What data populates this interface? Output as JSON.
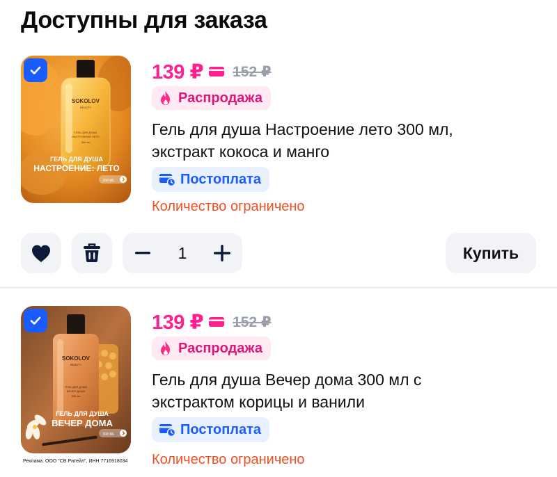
{
  "section": {
    "title": "Доступны для заказа"
  },
  "products": [
    {
      "price_now": "139 ₽",
      "price_old": "152 ₽",
      "sale_label": "Распродажа",
      "title_line1": "Гель для душа Настроение лето 300 мл,",
      "title_line2": "экстракт кокоса и манго",
      "payment_label": "Постоплата",
      "availability": "Количество ограничено",
      "quantity": "1",
      "buy_label": "Купить",
      "image": {
        "brand": "SOKOLOV",
        "brand_sub": "BEAUTY",
        "caption_line1": "ГЕЛЬ ДЛЯ ДУША",
        "caption_line2": "НАСТРОЕНИЕ: ЛЕТО",
        "volume": "300 ML",
        "bottle_label_line1": "ГЕЛЬ ДЛЯ ДУША",
        "bottle_label_line2": "НАСТРОЕНИЕ ЛЕТО",
        "bottle_volume": "300 мл"
      }
    },
    {
      "price_now": "139 ₽",
      "price_old": "152 ₽",
      "sale_label": "Распродажа",
      "title_line1": "Гель для душа Вечер дома 300 мл с",
      "title_line2": "экстрактом корицы и ванили",
      "payment_label": "Постоплата",
      "availability": "Количество ограничено",
      "ad_note": "Реклама. ООО \"СВ Ритейл\", ИНН 7716918034",
      "image": {
        "brand": "SOKOLOV",
        "brand_sub": "BEAUTY",
        "caption_line1": "ГЕЛЬ ДЛЯ ДУША",
        "caption_line2": "ВЕЧЕР ДОМА",
        "volume": "300 ML",
        "bottle_label_line1": "ГЕЛЬ ДЛЯ ДУША",
        "bottle_label_line2": "ВЕЧЕР ДОМА",
        "bottle_volume": "300 мл"
      }
    }
  ],
  "colors": {
    "price": "#ff1f8f",
    "sale_bg": "#ffeaf3",
    "sale_text": "#e0167a",
    "post_bg": "#e9f1ff",
    "post_text": "#1a5cff",
    "limited": "#f14f1f",
    "checkbox": "#1a5cff",
    "button_bg": "#f1f3f6"
  },
  "icons": [
    "checkmark-icon",
    "card-icon",
    "fire-icon",
    "postpay-icon",
    "heart-icon",
    "trash-icon",
    "minus-icon",
    "plus-icon",
    "chevron-right-icon"
  ]
}
